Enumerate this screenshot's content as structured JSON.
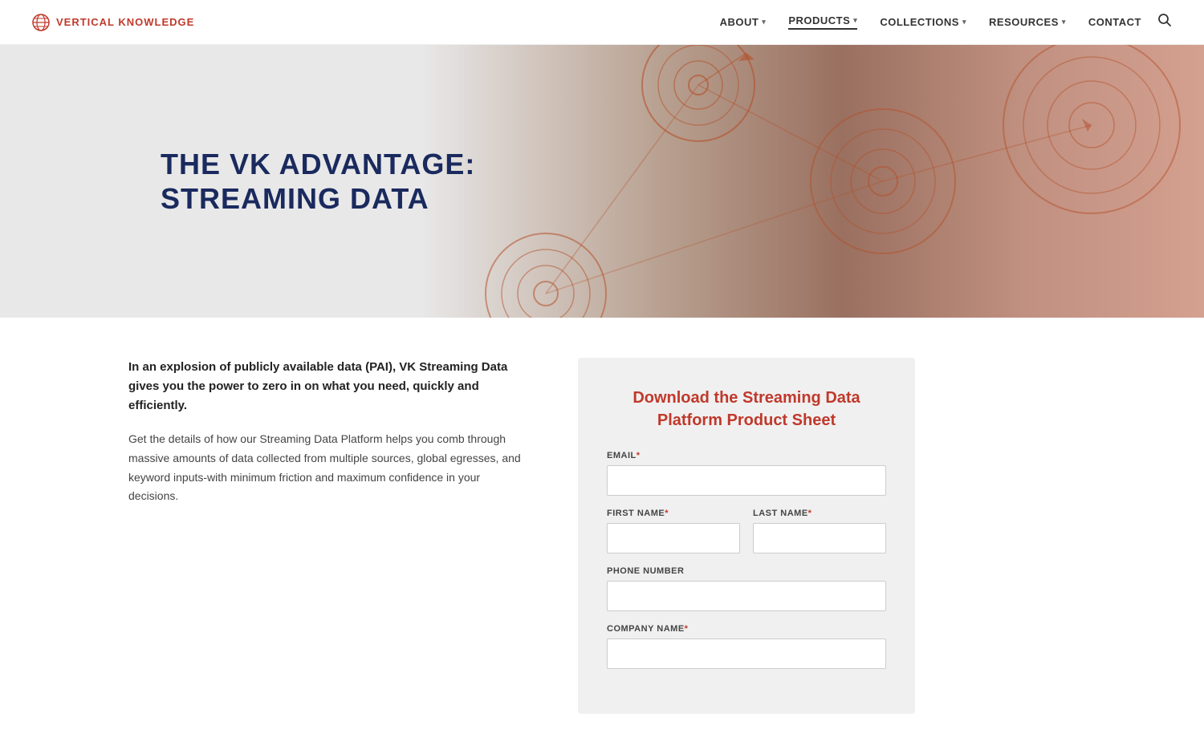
{
  "nav": {
    "logo_text": "VERTICAL KNOWLEDGE",
    "links": [
      {
        "label": "ABOUT",
        "has_dropdown": true,
        "active": false
      },
      {
        "label": "PRODUCTS",
        "has_dropdown": true,
        "active": true
      },
      {
        "label": "COLLECTIONS",
        "has_dropdown": true,
        "active": false
      },
      {
        "label": "RESOURCES",
        "has_dropdown": true,
        "active": false
      },
      {
        "label": "CONTACT",
        "has_dropdown": false,
        "active": false
      }
    ]
  },
  "hero": {
    "title_line1": "THE VK ADVANTAGE:",
    "title_line2": "STREAMING DATA"
  },
  "left_section": {
    "intro_bold": "In an explosion of publicly available data (PAI), VK Streaming Data gives you the power to zero in on what you need, quickly and efficiently.",
    "intro_body": "Get the details of how our Streaming Data Platform helps you comb through massive amounts of data collected from multiple sources, global egresses, and keyword inputs-with minimum friction and maximum confidence in your decisions."
  },
  "form": {
    "title": "Download the Streaming Data Platform Product Sheet",
    "fields": [
      {
        "id": "email",
        "label": "EMAIL",
        "required": true,
        "type": "text",
        "full_width": true
      },
      {
        "id": "first_name",
        "label": "FIRST NAME",
        "required": true,
        "type": "text",
        "full_width": false
      },
      {
        "id": "last_name",
        "label": "LAST NAME",
        "required": true,
        "type": "text",
        "full_width": false
      },
      {
        "id": "phone",
        "label": "PHONE NUMBER",
        "required": false,
        "type": "text",
        "full_width": true
      },
      {
        "id": "company",
        "label": "COMPANY NAME",
        "required": true,
        "type": "text",
        "full_width": true
      }
    ]
  },
  "colors": {
    "accent": "#c0392b",
    "nav_active": "#1a1a1a",
    "hero_title": "#1a2a5e"
  }
}
